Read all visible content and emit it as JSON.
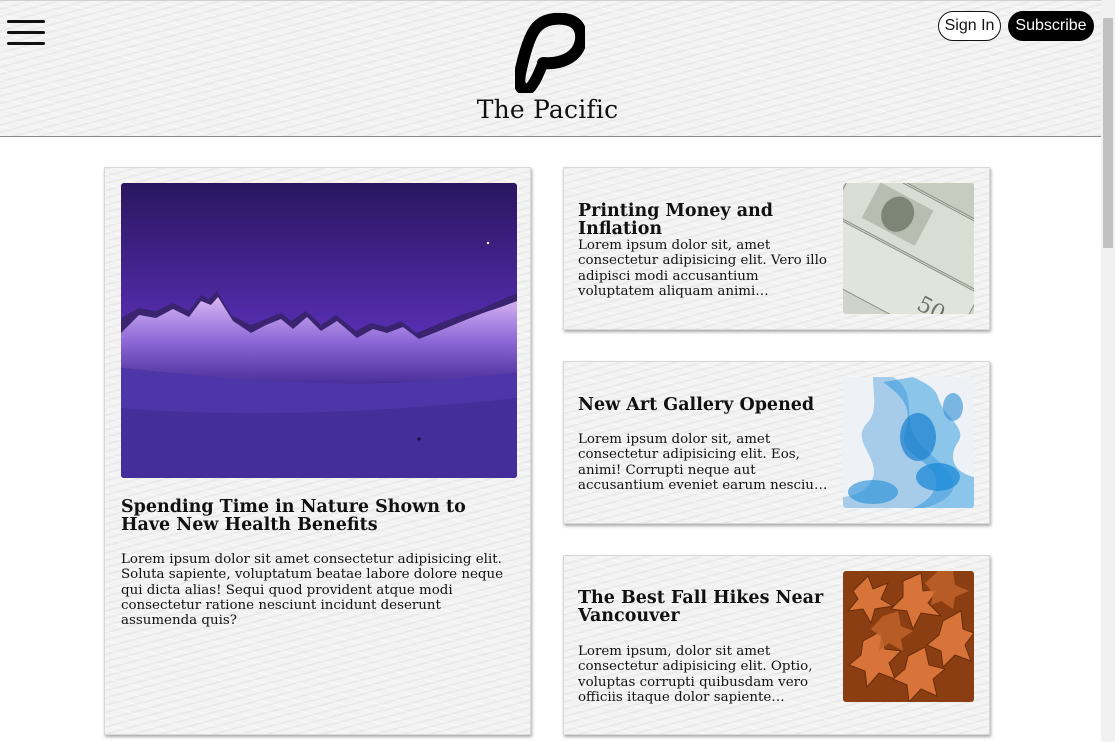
{
  "header": {
    "site_title": "The Pacific",
    "signin_label": "Sign In",
    "subscribe_label": "Subscribe"
  },
  "featured": {
    "title": "Spending Time in Nature Shown to Have New Health Benefits",
    "excerpt": "Lorem ipsum dolor sit amet consectetur adipisicing elit. Soluta sapiente, voluptatum beatae labore dolore neque qui dicta alias! Sequi quod provident atque modi consectetur ratione nesciunt incidunt deserunt assumenda quis?",
    "image": "mountain-night-photo"
  },
  "articles": [
    {
      "title": "Printing Money and Inflation",
      "excerpt": "Lorem ipsum dolor sit, amet consectetur adipisicing elit. Vero illo adipisci modi accusantium voluptatem aliquam animi voluptatum, eum saepe provident…",
      "image": "dollar-bills-photo"
    },
    {
      "title": "New Art Gallery Opened",
      "excerpt": "Lorem ipsum dolor sit, amet consectetur adipisicing elit. Eos, animi! Corrupti neque aut accusantium eveniet earum nesciunt modi libero optio soluta…",
      "image": "blue-ink-photo"
    },
    {
      "title": "The Best Fall Hikes Near Vancouver",
      "excerpt": "Lorem ipsum, dolor sit amet consectetur adipisicing elit. Optio, voluptas corrupti quibusdam vero officiis itaque dolor sapiente eligendi, voluptatibus ratione…",
      "image": "autumn-leaves-photo"
    }
  ]
}
